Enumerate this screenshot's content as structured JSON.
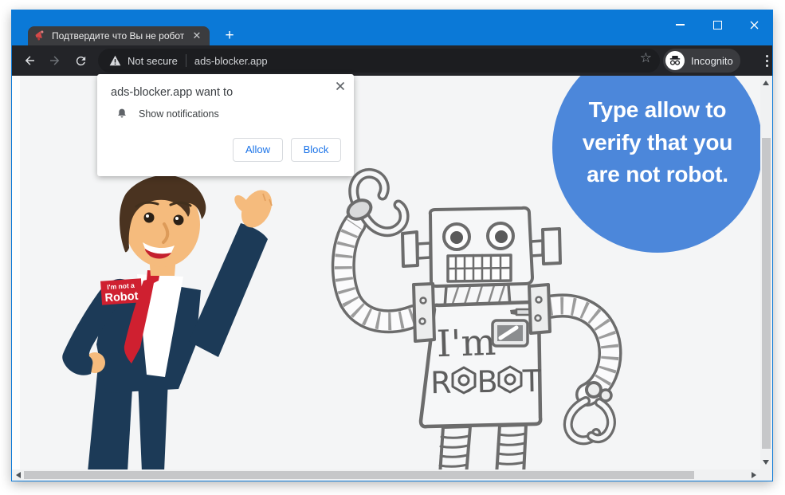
{
  "window": {
    "tab_title": "Подтвердите что Вы не робот"
  },
  "toolbar": {
    "security_label": "Not secure",
    "url": "ads-blocker.app",
    "incognito_label": "Incognito",
    "star": "☆"
  },
  "dialog": {
    "title": "ads-blocker.app want to",
    "permission_label": "Show notifications",
    "allow_label": "Allow",
    "block_label": "Block"
  },
  "bubble": {
    "lines": [
      "Type allow to",
      "verify that you",
      "are not robot."
    ],
    "color": "#4c87da"
  },
  "man_badge": {
    "line1": "I'm not a",
    "line2": "Robot"
  },
  "robot_label": {
    "line1": "I'm",
    "line2": "ROBOT"
  },
  "colors": {
    "titlebar": "#0b79d7",
    "toolbar": "#232428",
    "tab": "#3b3c3f",
    "page_bg": "#f4f5f6",
    "suit": "#1c3a57",
    "tie": "#cf2030",
    "skin": "#f5bb7d"
  }
}
